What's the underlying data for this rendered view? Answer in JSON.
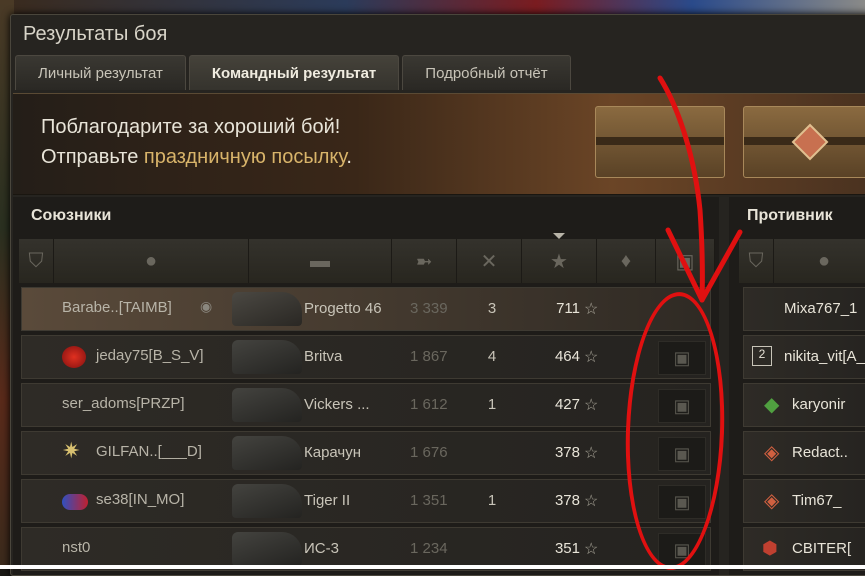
{
  "window": {
    "title": "Результаты боя"
  },
  "tabs": [
    {
      "label": "Личный результат"
    },
    {
      "label": "Командный результат"
    },
    {
      "label": "Подробный отчёт"
    }
  ],
  "banner": {
    "line1": "Поблагодарите за хороший бой!",
    "line2_prefix": "Отправьте ",
    "line2_link": "праздничную посылку",
    "line2_suffix": "."
  },
  "allies": {
    "title": "Союзники",
    "rows": [
      {
        "player": "Barabe..[TAIMB]",
        "vehicle": "Progetto 46",
        "damage": "3 339",
        "kills": "3",
        "xp": "711"
      },
      {
        "player": "jeday75[B_S_V]",
        "vehicle": "Britva",
        "damage": "1 867",
        "kills": "4",
        "xp": "464"
      },
      {
        "player": "ser_adoms[PRZP]",
        "vehicle": "Vickers ...",
        "damage": "1 612",
        "kills": "1",
        "xp": "427"
      },
      {
        "player": "GILFAN..[___D]",
        "vehicle": "Карачун",
        "damage": "1 676",
        "kills": "",
        "xp": "378"
      },
      {
        "player": "se38[IN_MO]",
        "vehicle": "Tiger II",
        "damage": "1 351",
        "kills": "1",
        "xp": "378"
      },
      {
        "player": "nst0",
        "vehicle": "ИС-3",
        "damage": "1 234",
        "kills": "",
        "xp": "351"
      }
    ]
  },
  "enemies": {
    "title": "Противник",
    "rows": [
      {
        "player": "Mixa767_1"
      },
      {
        "player": "nikita_vit[A_"
      },
      {
        "player": "karyonir"
      },
      {
        "player": "Redact.."
      },
      {
        "player": "Tim67_"
      },
      {
        "player": "CBITER["
      }
    ]
  },
  "icons": {
    "star": "star-icon",
    "gift": "gift-icon"
  },
  "colors": {
    "accent_link": "#d8b46a",
    "annotation": "#e01010"
  }
}
